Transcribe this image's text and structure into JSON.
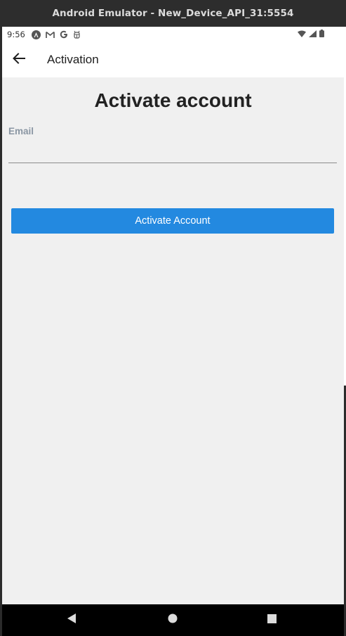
{
  "window": {
    "title": "Android Emulator - New_Device_API_31:5554"
  },
  "status_bar": {
    "time": "9:56",
    "notification_icons": [
      "anchor-icon",
      "gmail-icon",
      "google-icon",
      "android-debug-icon"
    ],
    "system_icons": [
      "wifi-icon",
      "signal-icon",
      "battery-icon"
    ]
  },
  "app_bar": {
    "title": "Activation",
    "back_icon": "arrow-left-icon"
  },
  "form": {
    "heading": "Activate account",
    "email_label": "Email",
    "email_value": "",
    "button_label": "Activate Account"
  },
  "nav_bar": {
    "buttons": [
      "back-triangle-icon",
      "home-circle-icon",
      "recents-square-icon"
    ]
  },
  "colors": {
    "accent": "#2389e0",
    "background": "#f0f0f0",
    "label": "#8a96a3",
    "heading": "#222222"
  }
}
